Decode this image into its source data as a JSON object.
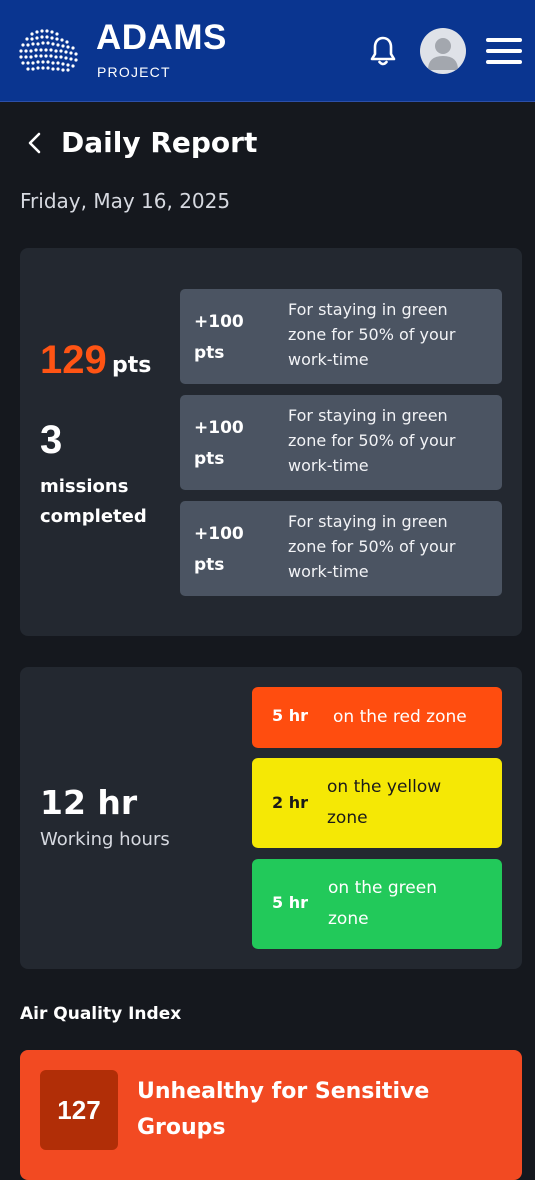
{
  "header": {
    "brand_title": "ADAMS",
    "brand_subtitle": "PROJECT",
    "accent_color": "#0a3590"
  },
  "page": {
    "title": "Daily Report",
    "date": "Friday, May 16, 2025"
  },
  "points_summary": {
    "points_value": "129",
    "points_unit": "pts",
    "missions_count": "3",
    "missions_label": "missions completed",
    "rewards": [
      {
        "amount": "+100 pts",
        "description": "For staying in green zone for 50% of your work-time"
      },
      {
        "amount": "+100 pts",
        "description": "For staying in green zone for 50% of your work-time"
      },
      {
        "amount": "+100 pts",
        "description": "For staying in green zone for 50% of your work-time"
      }
    ]
  },
  "working_hours": {
    "value": "12 hr",
    "label": "Working hours",
    "zones": [
      {
        "hours": "5 hr",
        "text": "on the red zone",
        "color": "#ff4d0f"
      },
      {
        "hours": "2 hr",
        "text": "on the yellow zone",
        "color": "#f5e805"
      },
      {
        "hours": "5 hr",
        "text": "on the green zone",
        "color": "#22c95a"
      }
    ]
  },
  "air_quality": {
    "heading": "Air Quality Index",
    "value": "127",
    "status": "Unhealthy for Sensitive Groups",
    "status_color": "#f24a22"
  },
  "icons": [
    "logo-icon",
    "bell-icon",
    "avatar-icon",
    "menu-icon",
    "back-arrow-icon"
  ]
}
